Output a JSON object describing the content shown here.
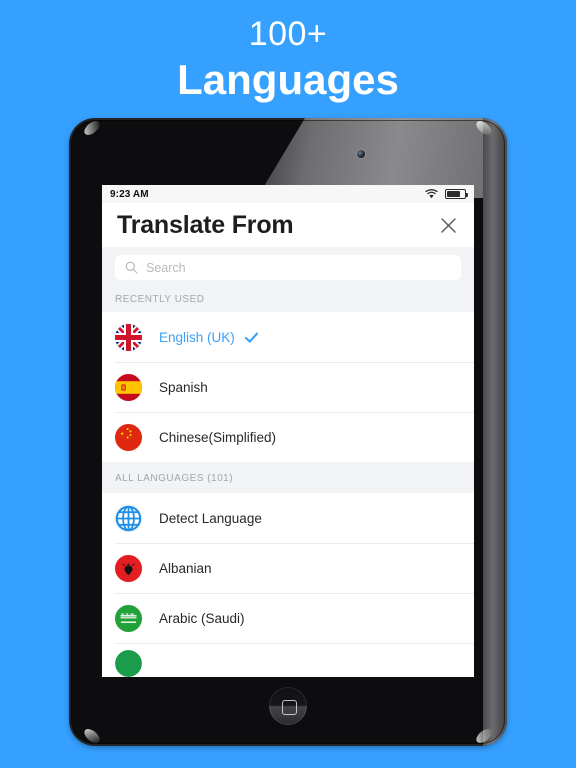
{
  "promo": {
    "line1": "100+",
    "line2": "Languages",
    "background_color": "#36a0ff",
    "text_color": "#ffffff"
  },
  "device": {
    "type": "tablet",
    "camera": "front-camera-dot",
    "home_button": "home-button"
  },
  "status_bar": {
    "time": "9:23 AM",
    "wifi_icon": "wifi-icon",
    "battery_icon": "battery-icon",
    "battery_level_percent": 70
  },
  "header": {
    "title": "Translate From",
    "close_icon": "close-icon"
  },
  "search": {
    "placeholder": "Search",
    "value": "",
    "icon": "search-icon"
  },
  "sections": [
    {
      "header": "RECENTLY USED",
      "items": [
        {
          "label": "English (UK)",
          "flag": "flag-uk",
          "selected": true,
          "check_icon": "check-icon"
        },
        {
          "label": "Spanish",
          "flag": "flag-spain",
          "selected": false
        },
        {
          "label": "Chinese(Simplified)",
          "flag": "flag-china",
          "selected": false
        }
      ]
    },
    {
      "header": "ALL LANGUAGES (101)",
      "items": [
        {
          "label": "Detect Language",
          "flag": "globe-icon",
          "selected": false
        },
        {
          "label": "Albanian",
          "flag": "flag-albania",
          "selected": false
        },
        {
          "label": "Arabic (Saudi)",
          "flag": "flag-saudi",
          "selected": false
        }
      ]
    }
  ],
  "colors": {
    "accent_blue": "#3ba0f5",
    "section_bg": "#f2f3f5",
    "text_primary": "#26282c",
    "text_muted": "#a2a7ae"
  }
}
